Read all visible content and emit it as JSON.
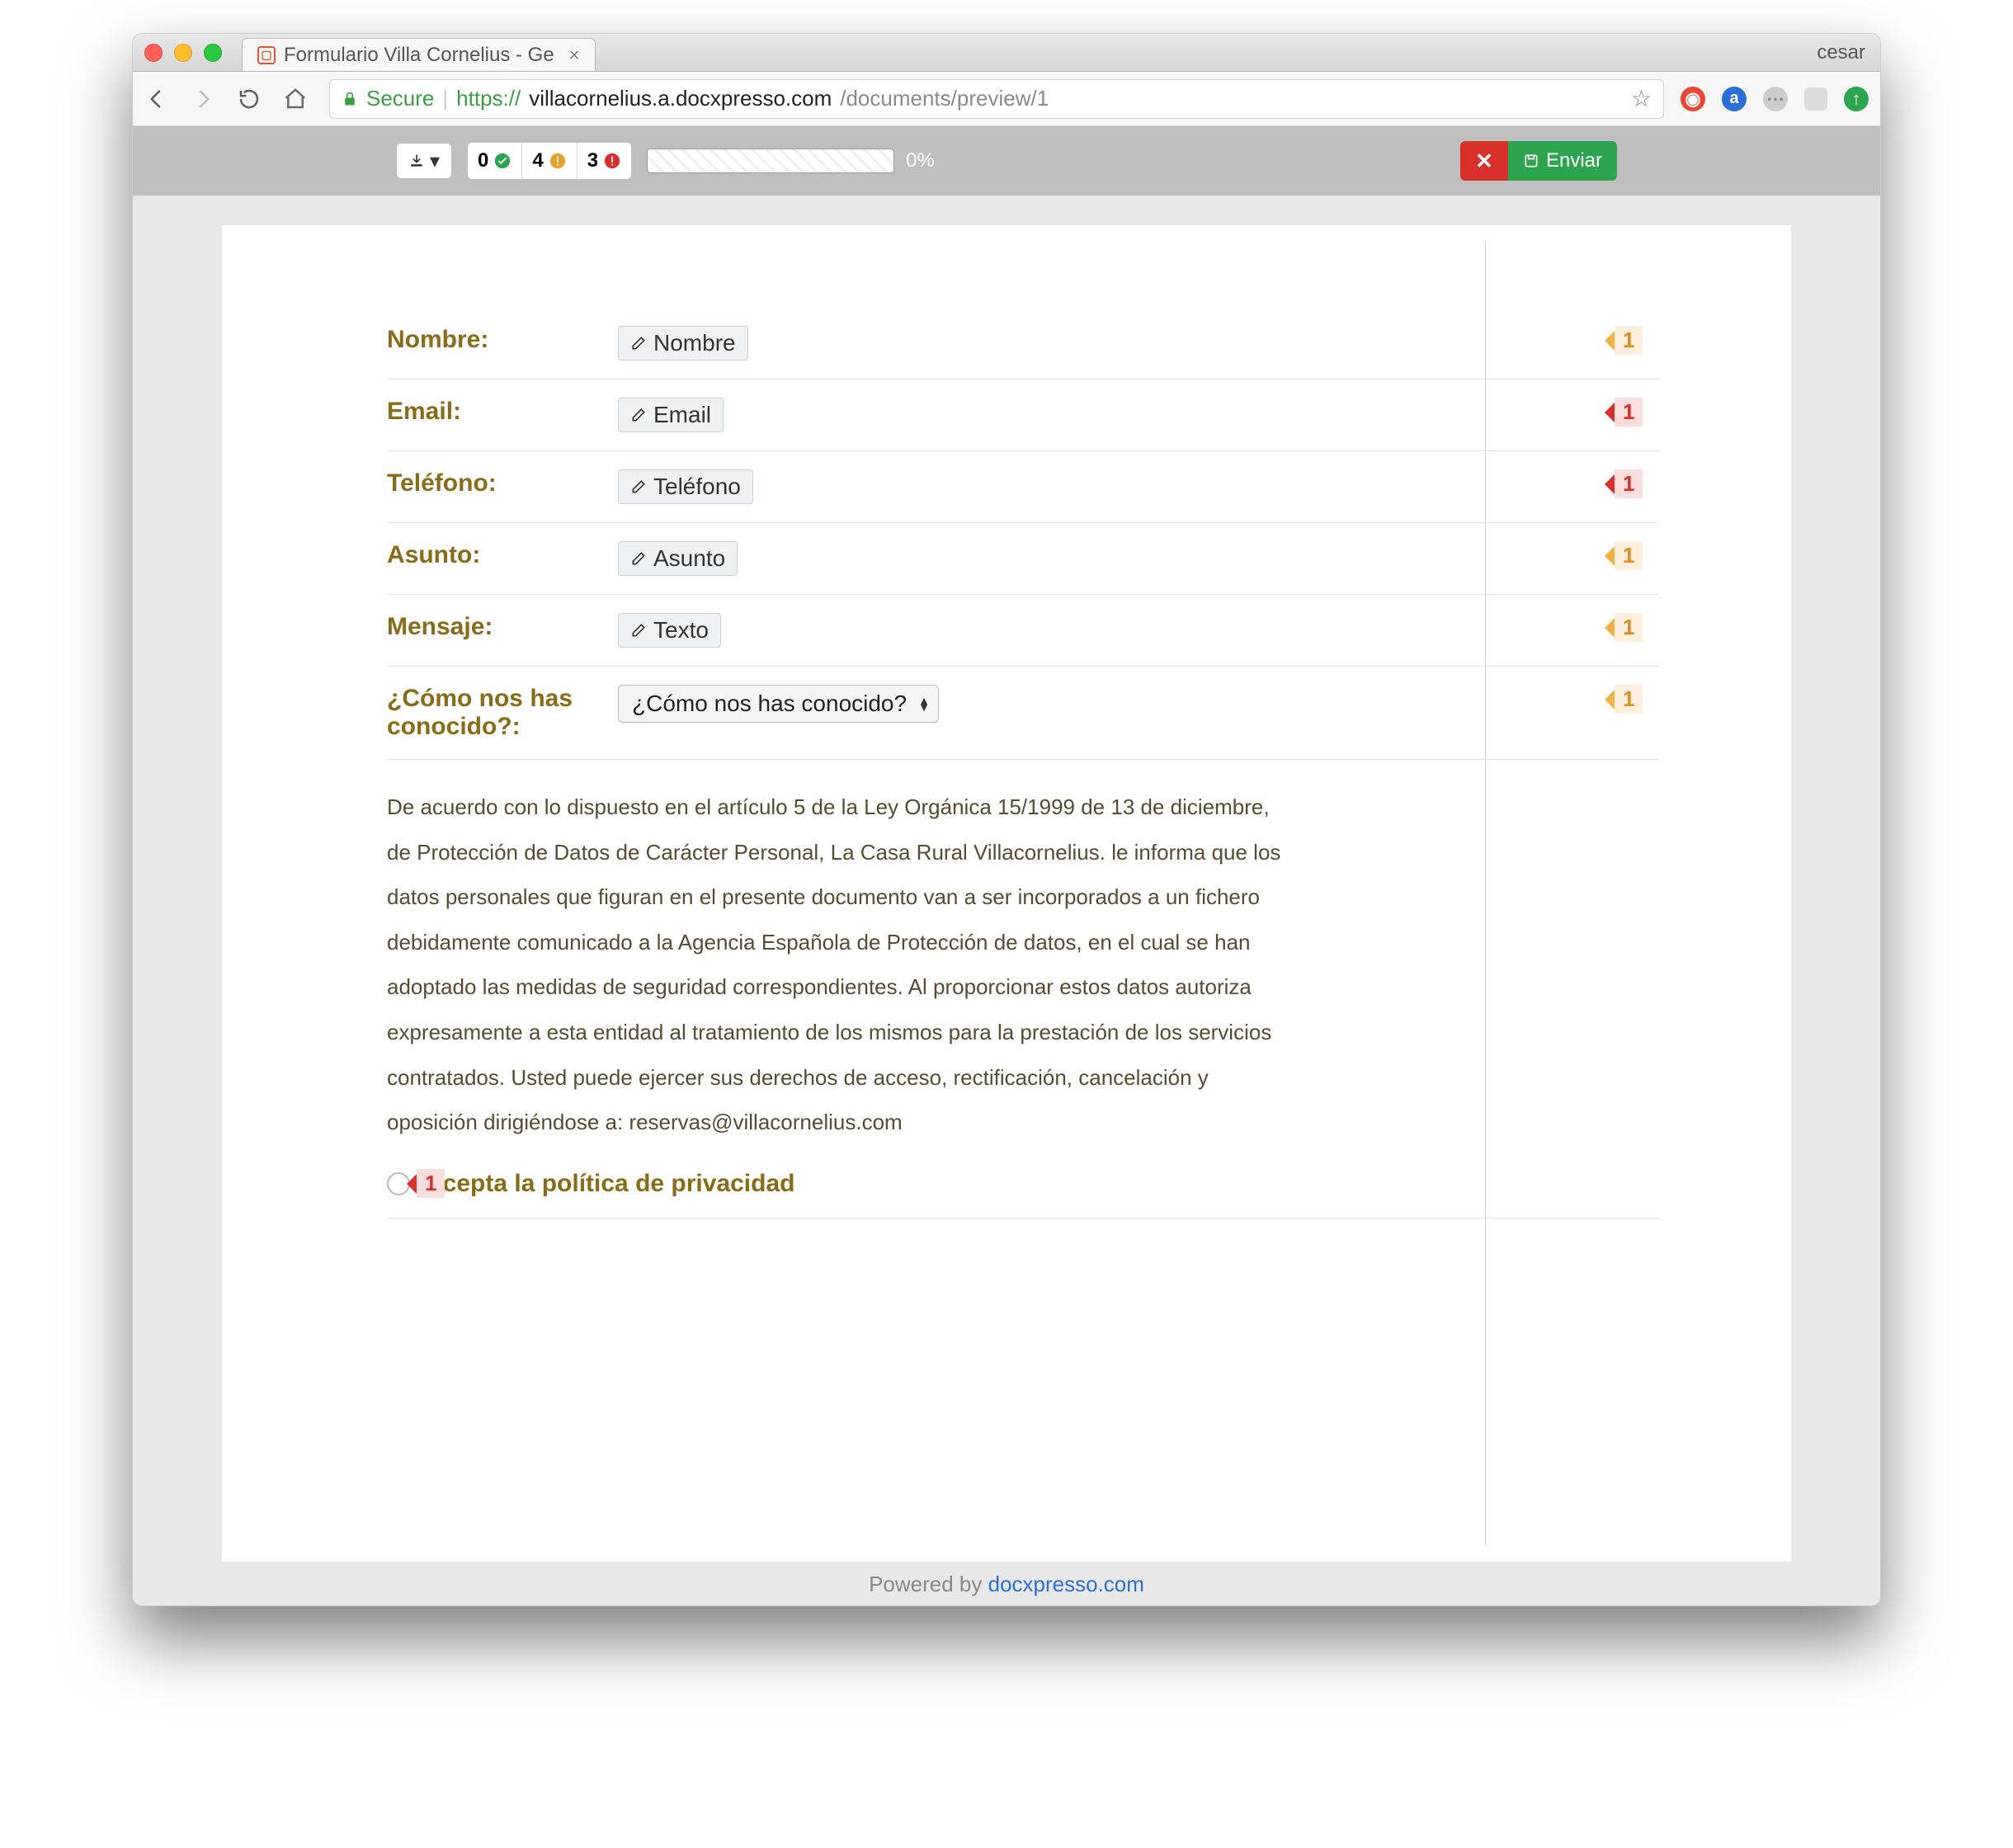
{
  "browser": {
    "tab_title": "Formulario Villa Cornelius - Ge",
    "user": "cesar",
    "secure_label": "Secure",
    "url_protocol": "https://",
    "url_host": "villacornelius.a.docxpresso.com",
    "url_path": "/documents/preview/1"
  },
  "appbar": {
    "stat_ok": "0",
    "stat_warn": "4",
    "stat_err": "3",
    "progress_pct": "0%",
    "send_label": "Enviar",
    "close_label": "✕"
  },
  "form": {
    "rows": [
      {
        "label": "Nombre:",
        "placeholder": "Nombre",
        "badge_type": "warn",
        "badge_n": "1"
      },
      {
        "label": "Email:",
        "placeholder": "Email",
        "badge_type": "err",
        "badge_n": "1"
      },
      {
        "label": "Teléfono:",
        "placeholder": "Teléfono",
        "badge_type": "err",
        "badge_n": "1"
      },
      {
        "label": "Asunto:",
        "placeholder": "Asunto",
        "badge_type": "warn",
        "badge_n": "1"
      },
      {
        "label": "Mensaje:",
        "placeholder": "Texto",
        "badge_type": "warn",
        "badge_n": "1"
      }
    ],
    "select_label": "¿Cómo nos has conocido?:",
    "select_value": "¿Cómo nos has conocido?",
    "select_badge_type": "warn",
    "select_badge_n": "1",
    "legal_text": "De acuerdo con lo dispuesto en el artículo 5 de la Ley Orgánica 15/1999 de 13 de diciembre, de Protección de Datos de Carácter Personal, La Casa Rural Villacornelius. le informa que los datos personales que figuran en el presente documento van a ser incorporados a un fichero debidamente comunicado a la Agencia Española de Protección de datos, en el cual se han adoptado las medidas de seguridad correspondientes. Al proporcionar estos datos autoriza expresamente a esta entidad al tratamiento de los mismos para la prestación de los servicios contratados. Usted puede ejercer sus derechos de acceso, rectificación, cancelación y oposición dirigiéndose a: reservas@villacornelius.com",
    "accept_label": "Acepta la política de privacidad",
    "accept_badge_type": "err",
    "accept_badge_n": "1"
  },
  "footer": {
    "powered": "Powered by",
    "brand": "docxpresso.com"
  }
}
